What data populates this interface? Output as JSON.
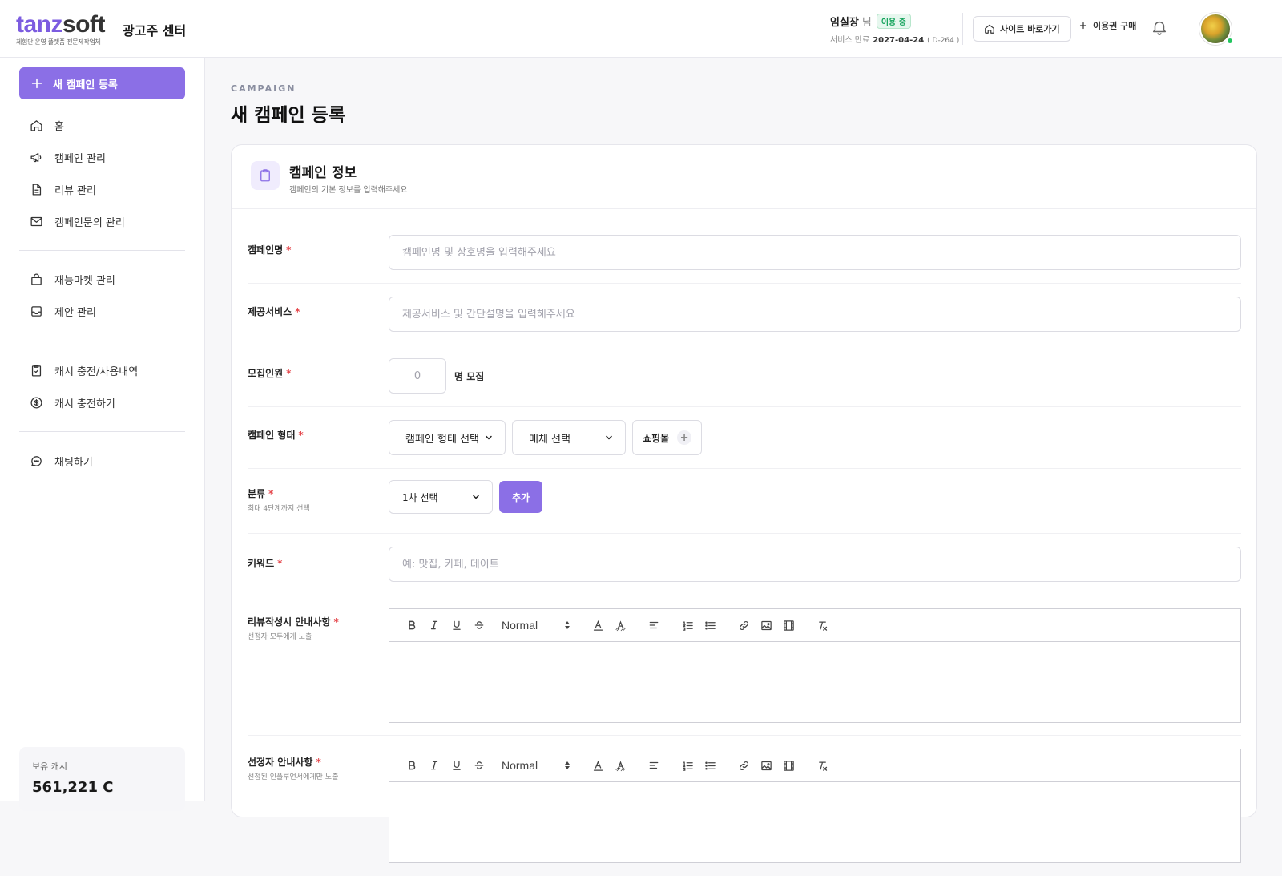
{
  "header": {
    "logo_part1": "tanz",
    "logo_part2": "soft",
    "logo_tagline": "체험단 운영 플랫폼 전문제작업체",
    "center_title": "광고주 센터",
    "user_name": "임실장",
    "user_suffix": "님",
    "status_badge": "이용 중",
    "expire_label": "서비스 만료",
    "expire_date": "2027-04-24",
    "expire_dday": "( D-264 )",
    "site_button": "사이트 바로가기",
    "buy_button": "이용권 구매"
  },
  "sidebar": {
    "new_campaign": "새 캠페인 등록",
    "group1": [
      {
        "label": "홈",
        "icon": "home-icon"
      },
      {
        "label": "캠페인 관리",
        "icon": "megaphone-icon"
      },
      {
        "label": "리뷰 관리",
        "icon": "document-icon"
      },
      {
        "label": "캠페인문의 관리",
        "icon": "mail-icon"
      }
    ],
    "group2": [
      {
        "label": "재능마켓 관리",
        "icon": "bag-icon"
      },
      {
        "label": "제안 관리",
        "icon": "inbox-icon"
      }
    ],
    "group3": [
      {
        "label": "캐시 충전/사용내역",
        "icon": "clipboard-check-icon"
      },
      {
        "label": "캐시 충전하기",
        "icon": "dollar-icon"
      }
    ],
    "group4": [
      {
        "label": "채팅하기",
        "icon": "chat-icon"
      }
    ],
    "cash_label": "보유 캐시",
    "cash_value": "561,221 C"
  },
  "page": {
    "eyebrow": "CAMPAIGN",
    "title": "새 캠페인 등록"
  },
  "card": {
    "title": "캠페인 정보",
    "subtitle": "캠페인의 기본 정보를 입력해주세요"
  },
  "form": {
    "required_mark": "*",
    "campaign_name": {
      "label": "캠페인명",
      "placeholder": "캠페인명 및 상호명을 입력해주세요"
    },
    "service": {
      "label": "제공서비스",
      "placeholder": "제공서비스 및 간단설명을 입력해주세요"
    },
    "recruit": {
      "label": "모집인원",
      "placeholder": "0",
      "suffix": "명 모집"
    },
    "campaign_type": {
      "label": "캠페인 형태",
      "type_select": "캠페인 형태 선택",
      "media_select": "매체 선택",
      "chip": "쇼핑몰"
    },
    "category": {
      "label": "분류",
      "hint": "최대 4단계까지 선택",
      "select": "1차 선택",
      "add_button": "추가"
    },
    "keyword": {
      "label": "키워드",
      "placeholder": "예: 맛집, 카페, 데이트"
    },
    "review_guide": {
      "label": "리뷰작성시 안내사항",
      "hint": "선정자 모두에게 노출"
    },
    "selected_guide": {
      "label": "선정자 안내사항",
      "hint": "선정된 인플루언서에게만 노출"
    },
    "editor_format": "Normal"
  }
}
